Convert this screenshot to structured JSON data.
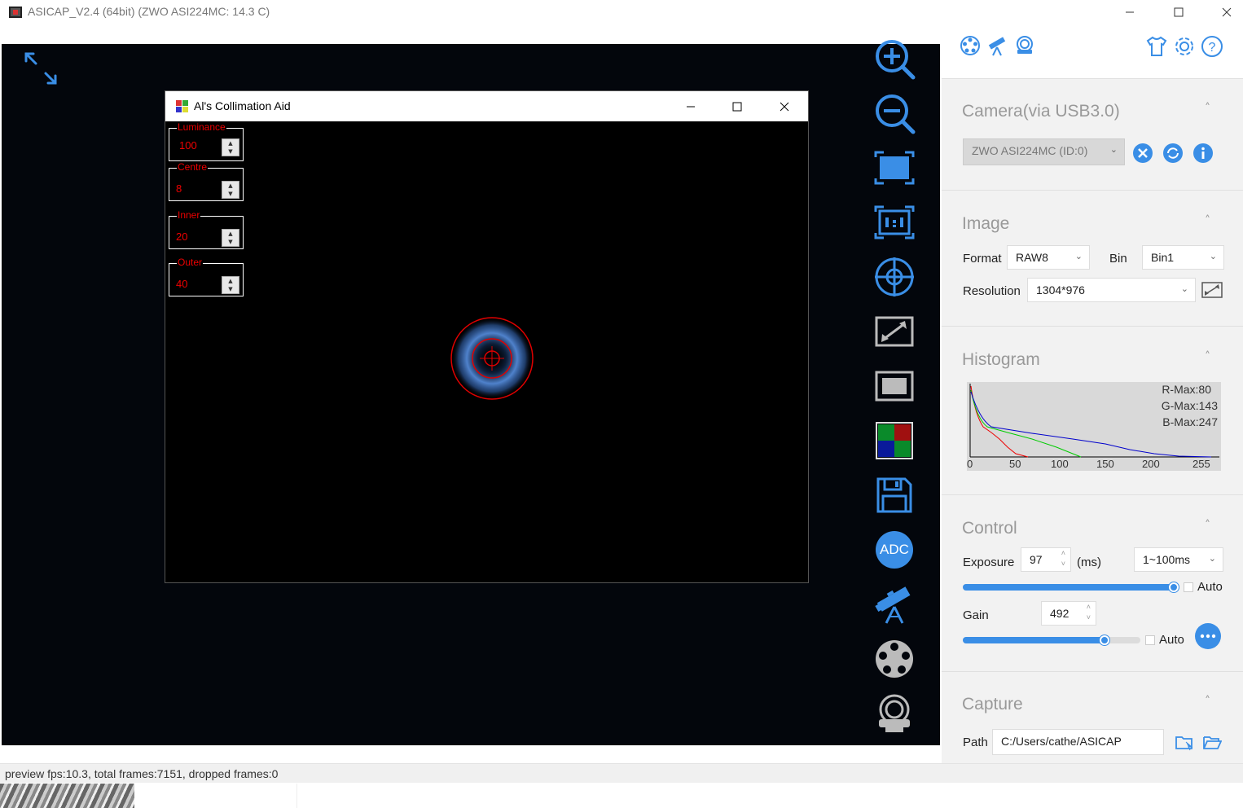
{
  "window": {
    "title": "ASICAP_V2.4 (64bit) (ZWO ASI224MC: 14.3 C)"
  },
  "toolbar": {
    "adc_label": "ADC"
  },
  "dialog": {
    "title": "Al's Collimation Aid",
    "controls": [
      {
        "label": "Luminance",
        "value": "100"
      },
      {
        "label": "Centre",
        "value": "8"
      },
      {
        "label": "Inner",
        "value": "20"
      },
      {
        "label": "Outer",
        "value": "40"
      }
    ]
  },
  "status": {
    "text": "preview fps:10.3, total frames:7151, dropped frames:0"
  },
  "sidebar": {
    "camera": {
      "title": "Camera(via USB3.0)",
      "device": "ZWO ASI224MC (ID:0)"
    },
    "image": {
      "title": "Image",
      "format_label": "Format",
      "format_value": "RAW8",
      "bin_label": "Bin",
      "bin_value": "Bin1",
      "resolution_label": "Resolution",
      "resolution_value": "1304*976"
    },
    "histogram": {
      "title": "Histogram",
      "r_max": "R-Max:80",
      "g_max": "G-Max:143",
      "b_max": "B-Max:247",
      "ticks": [
        "0",
        "50",
        "100",
        "150",
        "200",
        "255"
      ]
    },
    "control": {
      "title": "Control",
      "exposure_label": "Exposure",
      "exposure_value": "97",
      "exposure_unit": "(ms)",
      "exposure_range": "1~100ms",
      "exposure_auto": "Auto",
      "exposure_level": 0.98,
      "gain_label": "Gain",
      "gain_value": "492",
      "gain_auto": "Auto",
      "gain_level": 0.8
    },
    "capture": {
      "title": "Capture",
      "path_label": "Path",
      "path_value": "C:/Users/cathe/ASICAP"
    }
  },
  "colors": {
    "accent": "#3a8ee6",
    "preview_bg": "#03060c",
    "overlay_red": "#e00000",
    "sidebar_bg": "#f2f2f2"
  }
}
